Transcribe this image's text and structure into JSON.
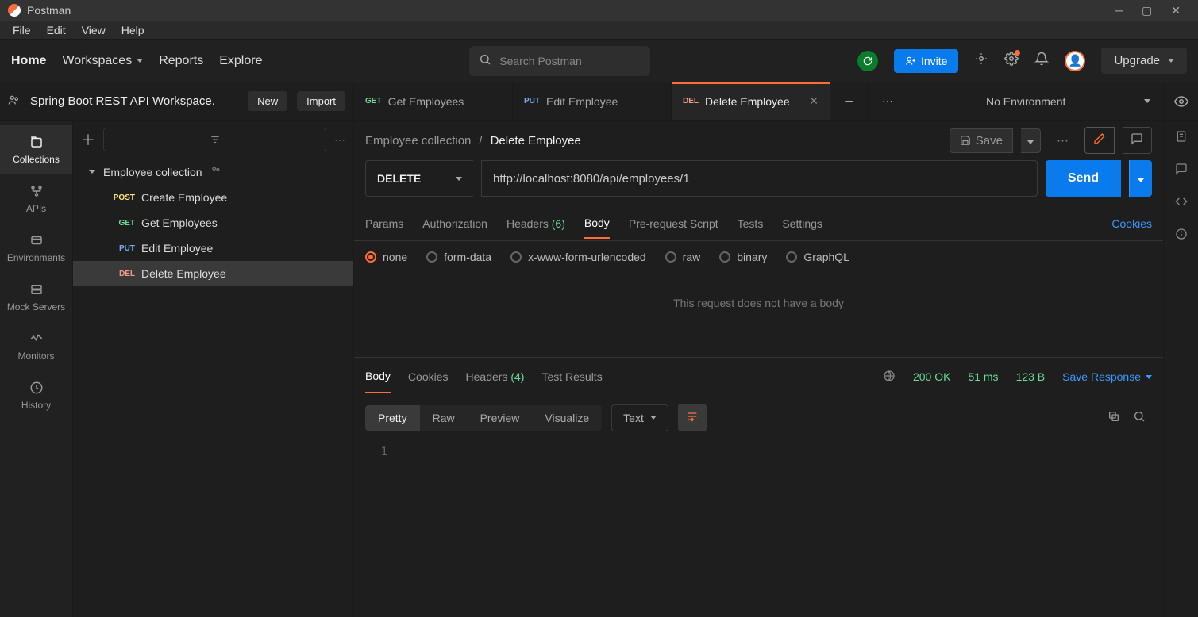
{
  "app_title": "Postman",
  "menu": {
    "file": "File",
    "edit": "Edit",
    "view": "View",
    "help": "Help"
  },
  "top_nav": {
    "home": "Home",
    "workspaces": "Workspaces",
    "reports": "Reports",
    "explore": "Explore",
    "search_placeholder": "Search Postman",
    "invite": "Invite",
    "upgrade": "Upgrade"
  },
  "workspace": {
    "name": "Spring Boot REST API Workspace.",
    "new_btn": "New",
    "import_btn": "Import"
  },
  "tabs": [
    {
      "method": "GET",
      "name": "Get Employees",
      "active": false
    },
    {
      "method": "PUT",
      "name": "Edit Employee",
      "active": false
    },
    {
      "method": "DEL",
      "name": "Delete Employee",
      "active": true
    }
  ],
  "environment": "No Environment",
  "rail": {
    "collections": "Collections",
    "apis": "APIs",
    "environments": "Environments",
    "mock_servers": "Mock Servers",
    "monitors": "Monitors",
    "history": "History"
  },
  "sidebar": {
    "collection": "Employee collection",
    "items": [
      {
        "method": "POST",
        "name": "Create Employee"
      },
      {
        "method": "GET",
        "name": "Get Employees"
      },
      {
        "method": "PUT",
        "name": "Edit Employee"
      },
      {
        "method": "DEL",
        "name": "Delete Employee"
      }
    ]
  },
  "breadcrumb": {
    "parent": "Employee collection",
    "sep": "/",
    "current": "Delete Employee"
  },
  "actions": {
    "save": "Save"
  },
  "request": {
    "method": "DELETE",
    "url": "http://localhost:8080/api/employees/1",
    "send": "Send"
  },
  "req_tabs": {
    "params": "Params",
    "auth": "Authorization",
    "headers": "Headers",
    "headers_count": "(6)",
    "body": "Body",
    "prereq": "Pre-request Script",
    "tests": "Tests",
    "settings": "Settings",
    "cookies": "Cookies"
  },
  "body_opts": {
    "none": "none",
    "formdata": "form-data",
    "xwww": "x-www-form-urlencoded",
    "raw": "raw",
    "binary": "binary",
    "graphql": "GraphQL"
  },
  "no_body_text": "This request does not have a body",
  "resp_tabs": {
    "body": "Body",
    "cookies": "Cookies",
    "headers": "Headers",
    "headers_count": "(4)",
    "test_results": "Test Results",
    "status": "200 OK",
    "time": "51 ms",
    "size": "123 B",
    "save_response": "Save Response"
  },
  "resp_tools": {
    "pretty": "Pretty",
    "raw": "Raw",
    "preview": "Preview",
    "visualize": "Visualize",
    "format": "Text"
  },
  "resp_body": {
    "line1_num": "1",
    "line1_text": ""
  }
}
